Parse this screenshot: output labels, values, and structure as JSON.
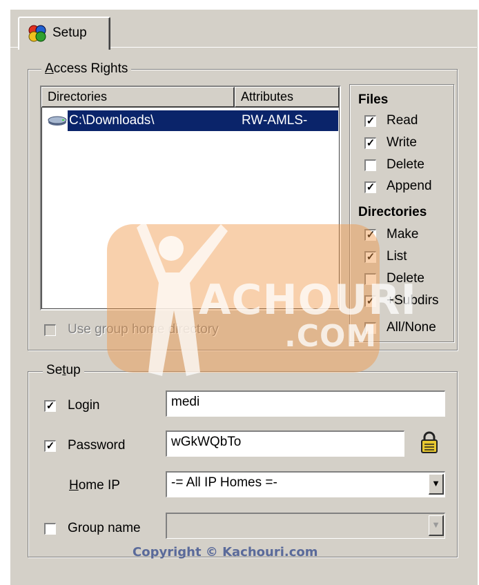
{
  "tab": {
    "label": "Setup",
    "icon": "setup-cubes-icon"
  },
  "access_rights": {
    "title": "Access Rights",
    "columns": [
      "Directories",
      "Attributes"
    ],
    "rows": [
      {
        "directory": "C:\\Downloads\\",
        "attributes": "RW-AMLS-",
        "icon": "drive-icon"
      }
    ],
    "use_group_home": {
      "label": "Use group home directory",
      "checked": false,
      "enabled": false
    }
  },
  "files": {
    "title": "Files",
    "items": [
      {
        "label": "Read",
        "checked": true
      },
      {
        "label": "Write",
        "checked": true
      },
      {
        "label": "Delete",
        "checked": false
      },
      {
        "label": "Append",
        "checked": true
      }
    ]
  },
  "directories": {
    "title": "Directories",
    "items": [
      {
        "label": "Make",
        "checked": true
      },
      {
        "label": "List",
        "checked": true
      },
      {
        "label": "Delete",
        "checked": false
      },
      {
        "label": "+Subdirs",
        "checked": true
      },
      {
        "label": "All/None",
        "checked": false
      }
    ]
  },
  "setup": {
    "title": "Setup",
    "login": {
      "label": "Login",
      "checked": true,
      "value": "medi"
    },
    "password": {
      "label": "Password",
      "checked": true,
      "value": "wGkWQbTo",
      "icon": "padlock-icon"
    },
    "home_ip": {
      "label": "Home IP",
      "value": "-= All IP Homes =-"
    },
    "group_name": {
      "label": "Group name",
      "checked": false,
      "value": ""
    }
  },
  "watermark": {
    "line1": "ACHOURI",
    "line2": ".COM",
    "letter": "K"
  },
  "copyright": "Copyright © Kachouri.com",
  "colors": {
    "selection": "#0a246a",
    "face": "#d4d0c8",
    "watermark": "#f09646"
  }
}
